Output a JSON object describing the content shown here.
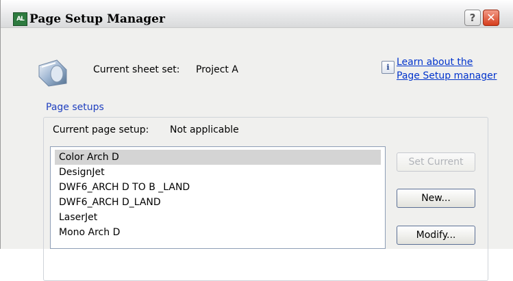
{
  "window": {
    "title": "Page Setup Manager",
    "help_label": "?",
    "close_label": "✕"
  },
  "sheet_set": {
    "label": "Current sheet set:",
    "value": "Project A"
  },
  "help_link": {
    "icon_glyph": "i",
    "line1": "Learn about the",
    "line2": "Page Setup manager"
  },
  "page_setups": {
    "group_label": "Page setups",
    "current_label": "Current page setup:",
    "current_value": "Not applicable",
    "items": [
      "Color Arch D",
      "DesignJet",
      "DWF6_ARCH D TO B _LAND",
      "DWF6_ARCH D_LAND",
      "LaserJet",
      "Mono Arch D"
    ],
    "selected_index": 0
  },
  "buttons": {
    "set_current": "Set Current",
    "new": "New...",
    "modify": "Modify..."
  }
}
